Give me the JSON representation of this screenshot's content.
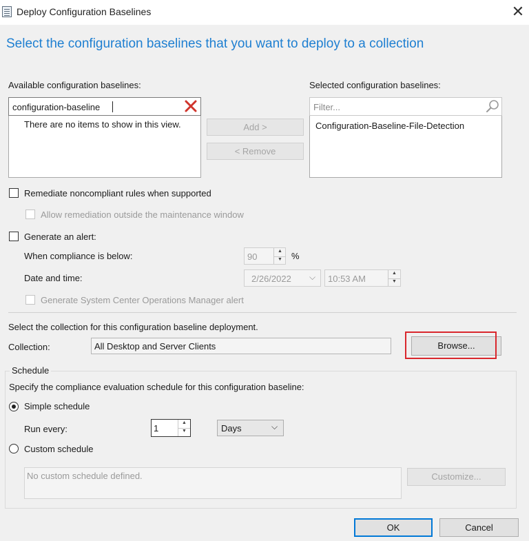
{
  "window": {
    "title": "Deploy Configuration Baselines",
    "close_icon": "close-icon"
  },
  "header": {
    "text": "Select the configuration baselines that you want to deploy to a collection"
  },
  "available": {
    "label": "Available configuration baselines:",
    "search_value": "configuration-baseline",
    "empty_text": "There are no items to show in this view."
  },
  "selected": {
    "label": "Selected configuration baselines:",
    "filter_placeholder": "Filter...",
    "items": [
      "Configuration-Baseline-File-Detection"
    ]
  },
  "buttons": {
    "add": "Add >",
    "remove": "< Remove",
    "browse": "Browse...",
    "customize": "Customize...",
    "ok": "OK",
    "cancel": "Cancel"
  },
  "remediate": {
    "label": "Remediate noncompliant rules when supported",
    "allow_label": "Allow remediation outside the maintenance window"
  },
  "alert": {
    "label": "Generate an alert:",
    "compliance_label": "When compliance is below:",
    "compliance_value": "90",
    "percent": "%",
    "datetime_label": "Date and time:",
    "date_value": "2/26/2022",
    "time_value": "10:53 AM",
    "scom_label": "Generate System Center Operations Manager alert"
  },
  "collection": {
    "instruction": "Select the collection for this configuration baseline deployment.",
    "label": "Collection:",
    "value": "All Desktop and Server Clients"
  },
  "schedule": {
    "group_label": "Schedule",
    "instruction": "Specify the compliance evaluation schedule for this configuration baseline:",
    "simple_label": "Simple schedule",
    "run_every_label": "Run every:",
    "run_every_value": "1",
    "unit_value": "Days",
    "custom_label": "Custom schedule",
    "custom_text": "No custom schedule defined."
  },
  "colors": {
    "header": "#1e7fd1",
    "highlight": "#d9262c",
    "ok_border": "#0078d7"
  }
}
